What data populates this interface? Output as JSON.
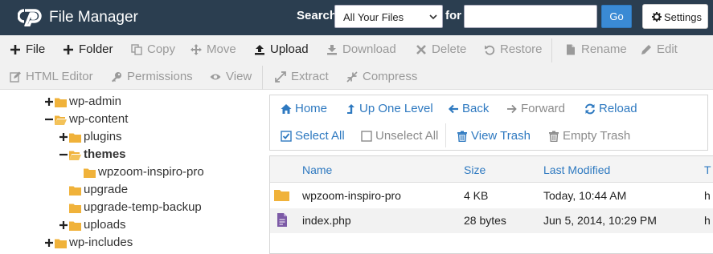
{
  "header": {
    "app_title": "File Manager",
    "search_label": "Search",
    "search_scope": "All Your Files",
    "for_label": "for",
    "search_value": "",
    "go_label": "Go",
    "settings_label": "Settings"
  },
  "toolbar": {
    "row1": [
      {
        "label": "File",
        "icon": "plus-icon",
        "enabled": true
      },
      {
        "label": "Folder",
        "icon": "plus-icon",
        "enabled": true
      },
      {
        "label": "Copy",
        "icon": "copy-icon",
        "enabled": false
      },
      {
        "label": "Move",
        "icon": "move-icon",
        "enabled": false
      },
      {
        "label": "Upload",
        "icon": "upload-icon",
        "enabled": true
      },
      {
        "label": "Download",
        "icon": "download-icon",
        "enabled": false
      },
      {
        "label": "Delete",
        "icon": "close-icon",
        "enabled": false
      },
      {
        "label": "Restore",
        "icon": "undo-icon",
        "enabled": false
      },
      {
        "label": "Rename",
        "icon": "file-icon",
        "enabled": false
      },
      {
        "label": "Edit",
        "icon": "pencil-icon",
        "enabled": false
      }
    ],
    "row2": [
      {
        "label": "HTML Editor",
        "icon": "edit-icon",
        "enabled": false
      },
      {
        "label": "Permissions",
        "icon": "key-icon",
        "enabled": false
      },
      {
        "label": "View",
        "icon": "eye-icon",
        "enabled": false
      },
      {
        "label": "Extract",
        "icon": "expand-icon",
        "enabled": false
      },
      {
        "label": "Compress",
        "icon": "compress-icon",
        "enabled": false
      }
    ]
  },
  "tree": [
    {
      "label": "wp-admin",
      "toggle": "+",
      "folder": true
    },
    {
      "label": "wp-content",
      "toggle": "−",
      "folder": true
    },
    {
      "label": "plugins",
      "toggle": "+",
      "folder": true
    },
    {
      "label": "themes",
      "toggle": "−",
      "folder": true,
      "selected": true
    },
    {
      "label": "wpzoom-inspiro-pro",
      "toggle": "",
      "folder": true
    },
    {
      "label": "upgrade",
      "toggle": "",
      "folder": true
    },
    {
      "label": "upgrade-temp-backup",
      "toggle": "",
      "folder": true
    },
    {
      "label": "uploads",
      "toggle": "+",
      "folder": true
    },
    {
      "label": "wp-includes",
      "toggle": "+",
      "folder": true
    }
  ],
  "nav": {
    "home": "Home",
    "up": "Up One Level",
    "back": "Back",
    "forward": "Forward",
    "reload": "Reload",
    "select_all": "Select All",
    "unselect_all": "Unselect All",
    "view_trash": "View Trash",
    "empty_trash": "Empty Trash"
  },
  "grid": {
    "columns": [
      "Name",
      "Size",
      "Last Modified",
      "T"
    ],
    "rows": [
      {
        "type": "folder",
        "name": "wpzoom-inspiro-pro",
        "size": "4 KB",
        "modified": "Today, 10:44 AM",
        "t": "h"
      },
      {
        "type": "file",
        "name": "index.php",
        "size": "28 bytes",
        "modified": "Jun 5, 2014, 10:29 PM",
        "t": "h"
      }
    ]
  },
  "colors": {
    "header_bg": "#2b3e50",
    "accent_blue": "#2e79c0",
    "go_button": "#3a8ad4",
    "folder_yellow": "#f0b23a",
    "php_file_purple": "#7c5aa6"
  }
}
